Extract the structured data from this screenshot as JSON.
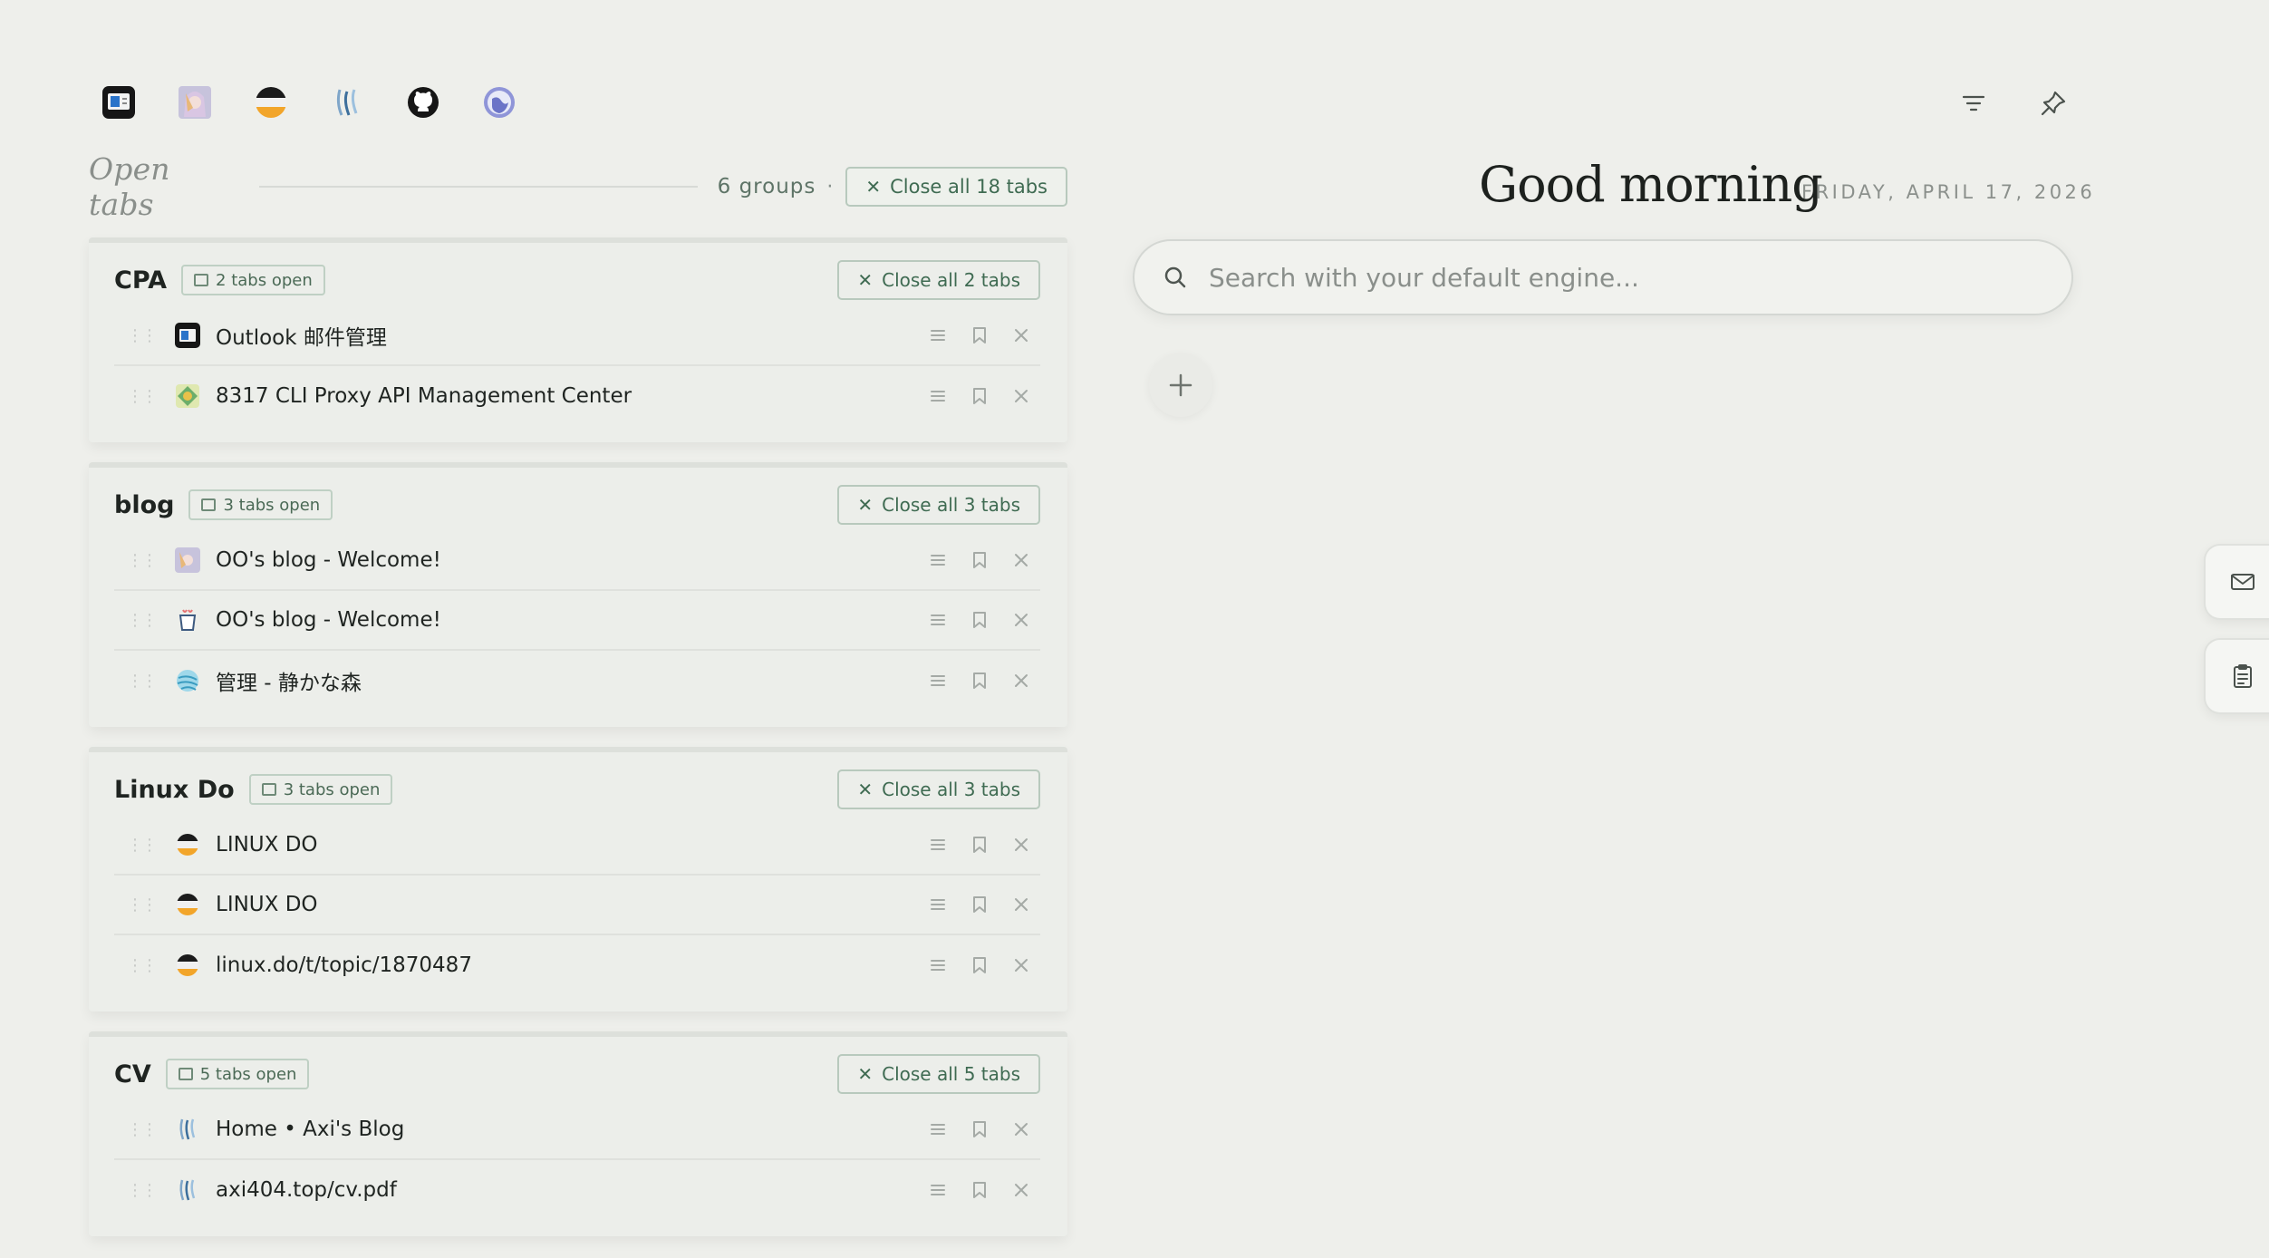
{
  "quick_links": [
    {
      "name": "outlook-icon"
    },
    {
      "name": "anime-avatar-icon"
    },
    {
      "name": "linux-do-icon"
    },
    {
      "name": "axi-blog-icon"
    },
    {
      "name": "github-icon"
    },
    {
      "name": "globe-icon"
    }
  ],
  "open_tabs": {
    "title": "Open tabs",
    "group_count": "6 groups",
    "separator": "·",
    "close_all_label": "Close all 18 tabs"
  },
  "groups": [
    {
      "name": "CPA",
      "count_label": "2 tabs open",
      "close_label": "Close all 2 tabs",
      "tabs": [
        {
          "title": "Outlook 邮件管理",
          "icon": "outlook-icon"
        },
        {
          "title": "8317 CLI Proxy API Management Center",
          "icon": "proxy-icon"
        }
      ]
    },
    {
      "name": "blog",
      "count_label": "3 tabs open",
      "close_label": "Close all 3 tabs",
      "tabs": [
        {
          "title": "OO's blog - Welcome!",
          "icon": "anime-avatar-icon"
        },
        {
          "title": "OO's blog - Welcome!",
          "icon": "cup-icon"
        },
        {
          "title": "管理 - 静かな森",
          "icon": "yarn-ball-icon"
        }
      ]
    },
    {
      "name": "Linux Do",
      "count_label": "3 tabs open",
      "close_label": "Close all 3 tabs",
      "tabs": [
        {
          "title": "LINUX DO",
          "icon": "linux-do-icon"
        },
        {
          "title": "LINUX DO",
          "icon": "linux-do-icon"
        },
        {
          "title": "linux.do/t/topic/1870487",
          "icon": "linux-do-icon"
        }
      ]
    },
    {
      "name": "CV",
      "count_label": "5 tabs open",
      "close_label": "Close all 5 tabs",
      "tabs": [
        {
          "title": "Home • Axi's Blog",
          "icon": "axi-blog-icon"
        },
        {
          "title": "axi404.top/cv.pdf",
          "icon": "axi-blog-icon"
        }
      ]
    }
  ],
  "greeting": "Good morning",
  "date": "FRIDAY, APRIL 17, 2026",
  "search": {
    "placeholder": "Search with your default engine..."
  },
  "colors": {
    "background": "#eeefeb",
    "accent": "#3f6b52",
    "border": "#b8c9bd"
  }
}
